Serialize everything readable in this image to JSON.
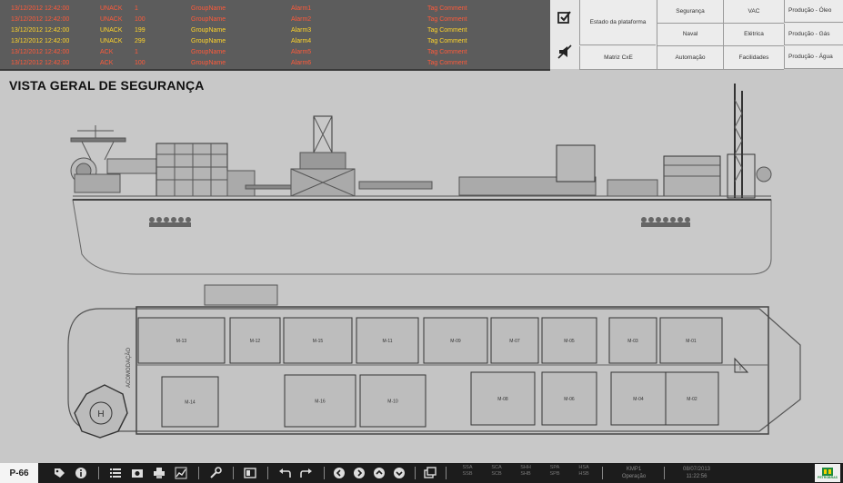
{
  "alarms": [
    {
      "datetime": "13/12/2012 12:42:00",
      "state": "UNACK",
      "value": "1",
      "group": "GroupName",
      "alarm": "Alarm1",
      "comment": "Tag Comment",
      "color": "#ff5a3a"
    },
    {
      "datetime": "13/12/2012 12:42:00",
      "state": "UNACK",
      "value": "100",
      "group": "GroupName",
      "alarm": "Alarm2",
      "comment": "Tag Comment",
      "color": "#ff5a3a"
    },
    {
      "datetime": "13/12/2012 12:42:00",
      "state": "UNACK",
      "value": "199",
      "group": "GroupName",
      "alarm": "Alarm3",
      "comment": "Tag Comment",
      "color": "#ffd42a"
    },
    {
      "datetime": "13/12/2012 12:42:00",
      "state": "UNACK",
      "value": "299",
      "group": "GroupName",
      "alarm": "Alarm4",
      "comment": "Tag Comment",
      "color": "#ffd42a"
    },
    {
      "datetime": "13/12/2012 12:42:00",
      "state": "ACK",
      "value": "1",
      "group": "GroupName",
      "alarm": "Alarm5",
      "comment": "Tag Comment",
      "color": "#ff5a3a"
    },
    {
      "datetime": "13/12/2012 12:42:00",
      "state": "ACK",
      "value": "100",
      "group": "GroupName",
      "alarm": "Alarm6",
      "comment": "Tag Comment",
      "color": "#ff5a3a"
    }
  ],
  "header_icons": {
    "ack": "checkbox-check-icon",
    "silence": "horn-mute-icon"
  },
  "nav": {
    "estado": "Estado da plataforma",
    "matriz": "Matriz CxE",
    "seguranca": "Segurança",
    "naval": "Naval",
    "automacao": "Automação",
    "vac": "VAC",
    "eletrica": "Elétrica",
    "facilidades": "Facilidades",
    "prod_oleo": "Produção - Óleo",
    "prod_gas": "Produção - Gás",
    "prod_agua": "Produção - Água"
  },
  "page": {
    "title": "VISTA GERAL DE SEGURANÇA"
  },
  "plan": {
    "modules_top": [
      "M-13",
      "M-12",
      "M-15",
      "M-11",
      "M-09",
      "M-07",
      "M-05",
      "M-03",
      "M-01"
    ],
    "modules_bottom": [
      "M-14",
      "M-16",
      "M-10",
      "M-08",
      "M-06",
      "M-04",
      "M-02"
    ],
    "side_label": "ACOMODAÇÃO"
  },
  "toolbar": {
    "platform": "P-66",
    "status_top": [
      "SSA",
      "SCA",
      "SHH",
      "SPA",
      "HSA"
    ],
    "status_bottom": [
      "SSB",
      "SCB",
      "SHB",
      "SPB",
      "HSB"
    ],
    "user": "KMP1",
    "mode": "Operação",
    "date": "08/07/2013",
    "time": "11:22:56",
    "brand": "PETROBRAS"
  }
}
